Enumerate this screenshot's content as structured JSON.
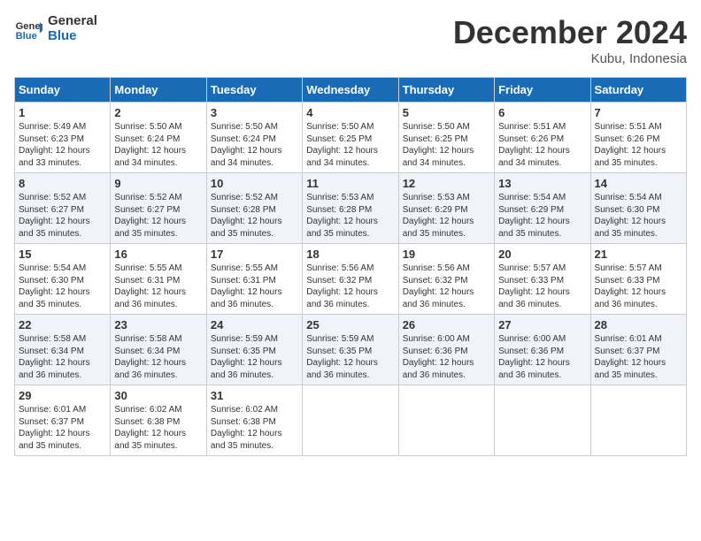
{
  "header": {
    "logo_line1": "General",
    "logo_line2": "Blue",
    "month_title": "December 2024",
    "location": "Kubu, Indonesia"
  },
  "weekdays": [
    "Sunday",
    "Monday",
    "Tuesday",
    "Wednesday",
    "Thursday",
    "Friday",
    "Saturday"
  ],
  "weeks": [
    [
      {
        "day": "1",
        "sunrise": "5:49 AM",
        "sunset": "6:23 PM",
        "daylight": "12 hours and 33 minutes."
      },
      {
        "day": "2",
        "sunrise": "5:50 AM",
        "sunset": "6:24 PM",
        "daylight": "12 hours and 34 minutes."
      },
      {
        "day": "3",
        "sunrise": "5:50 AM",
        "sunset": "6:24 PM",
        "daylight": "12 hours and 34 minutes."
      },
      {
        "day": "4",
        "sunrise": "5:50 AM",
        "sunset": "6:25 PM",
        "daylight": "12 hours and 34 minutes."
      },
      {
        "day": "5",
        "sunrise": "5:50 AM",
        "sunset": "6:25 PM",
        "daylight": "12 hours and 34 minutes."
      },
      {
        "day": "6",
        "sunrise": "5:51 AM",
        "sunset": "6:26 PM",
        "daylight": "12 hours and 34 minutes."
      },
      {
        "day": "7",
        "sunrise": "5:51 AM",
        "sunset": "6:26 PM",
        "daylight": "12 hours and 35 minutes."
      }
    ],
    [
      {
        "day": "8",
        "sunrise": "5:52 AM",
        "sunset": "6:27 PM",
        "daylight": "12 hours and 35 minutes."
      },
      {
        "day": "9",
        "sunrise": "5:52 AM",
        "sunset": "6:27 PM",
        "daylight": "12 hours and 35 minutes."
      },
      {
        "day": "10",
        "sunrise": "5:52 AM",
        "sunset": "6:28 PM",
        "daylight": "12 hours and 35 minutes."
      },
      {
        "day": "11",
        "sunrise": "5:53 AM",
        "sunset": "6:28 PM",
        "daylight": "12 hours and 35 minutes."
      },
      {
        "day": "12",
        "sunrise": "5:53 AM",
        "sunset": "6:29 PM",
        "daylight": "12 hours and 35 minutes."
      },
      {
        "day": "13",
        "sunrise": "5:54 AM",
        "sunset": "6:29 PM",
        "daylight": "12 hours and 35 minutes."
      },
      {
        "day": "14",
        "sunrise": "5:54 AM",
        "sunset": "6:30 PM",
        "daylight": "12 hours and 35 minutes."
      }
    ],
    [
      {
        "day": "15",
        "sunrise": "5:54 AM",
        "sunset": "6:30 PM",
        "daylight": "12 hours and 35 minutes."
      },
      {
        "day": "16",
        "sunrise": "5:55 AM",
        "sunset": "6:31 PM",
        "daylight": "12 hours and 36 minutes."
      },
      {
        "day": "17",
        "sunrise": "5:55 AM",
        "sunset": "6:31 PM",
        "daylight": "12 hours and 36 minutes."
      },
      {
        "day": "18",
        "sunrise": "5:56 AM",
        "sunset": "6:32 PM",
        "daylight": "12 hours and 36 minutes."
      },
      {
        "day": "19",
        "sunrise": "5:56 AM",
        "sunset": "6:32 PM",
        "daylight": "12 hours and 36 minutes."
      },
      {
        "day": "20",
        "sunrise": "5:57 AM",
        "sunset": "6:33 PM",
        "daylight": "12 hours and 36 minutes."
      },
      {
        "day": "21",
        "sunrise": "5:57 AM",
        "sunset": "6:33 PM",
        "daylight": "12 hours and 36 minutes."
      }
    ],
    [
      {
        "day": "22",
        "sunrise": "5:58 AM",
        "sunset": "6:34 PM",
        "daylight": "12 hours and 36 minutes."
      },
      {
        "day": "23",
        "sunrise": "5:58 AM",
        "sunset": "6:34 PM",
        "daylight": "12 hours and 36 minutes."
      },
      {
        "day": "24",
        "sunrise": "5:59 AM",
        "sunset": "6:35 PM",
        "daylight": "12 hours and 36 minutes."
      },
      {
        "day": "25",
        "sunrise": "5:59 AM",
        "sunset": "6:35 PM",
        "daylight": "12 hours and 36 minutes."
      },
      {
        "day": "26",
        "sunrise": "6:00 AM",
        "sunset": "6:36 PM",
        "daylight": "12 hours and 36 minutes."
      },
      {
        "day": "27",
        "sunrise": "6:00 AM",
        "sunset": "6:36 PM",
        "daylight": "12 hours and 36 minutes."
      },
      {
        "day": "28",
        "sunrise": "6:01 AM",
        "sunset": "6:37 PM",
        "daylight": "12 hours and 35 minutes."
      }
    ],
    [
      {
        "day": "29",
        "sunrise": "6:01 AM",
        "sunset": "6:37 PM",
        "daylight": "12 hours and 35 minutes."
      },
      {
        "day": "30",
        "sunrise": "6:02 AM",
        "sunset": "6:38 PM",
        "daylight": "12 hours and 35 minutes."
      },
      {
        "day": "31",
        "sunrise": "6:02 AM",
        "sunset": "6:38 PM",
        "daylight": "12 hours and 35 minutes."
      },
      null,
      null,
      null,
      null
    ]
  ]
}
